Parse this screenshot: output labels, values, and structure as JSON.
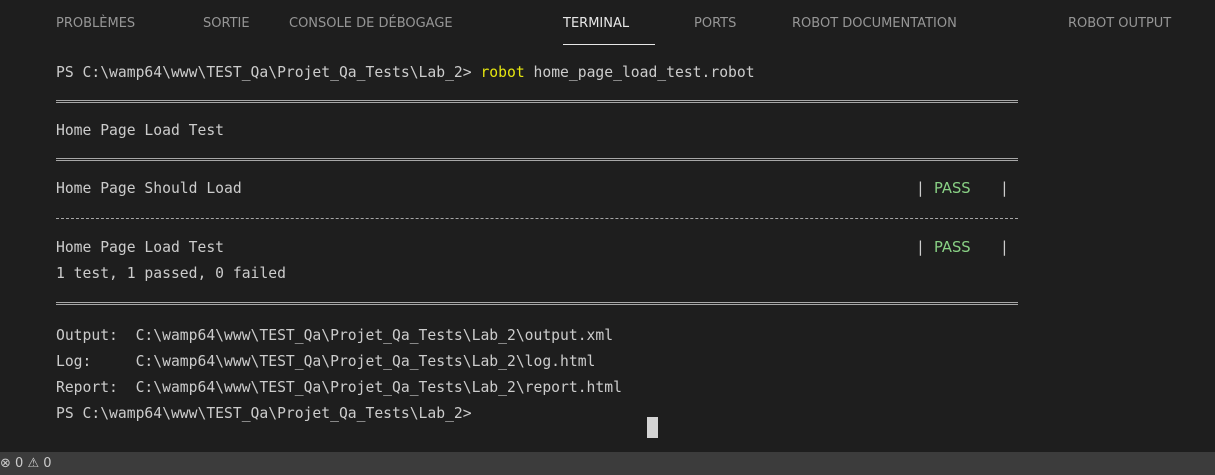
{
  "panel": {
    "tabs": [
      {
        "label": "PROBLÈMES"
      },
      {
        "label": "SORTIE"
      },
      {
        "label": "CONSOLE DE DÉBOGAGE"
      },
      {
        "label": "TERMINAL"
      },
      {
        "label": "PORTS"
      },
      {
        "label": "ROBOT DOCUMENTATION"
      },
      {
        "label": "ROBOT OUTPUT"
      }
    ],
    "active_tab": "TERMINAL"
  },
  "terminal": {
    "prompt1": "PS C:\\wamp64\\www\\TEST_Qa\\Projet_Qa_Tests\\Lab_2> ",
    "command": "robot",
    "command_args": " home_page_load_test.robot",
    "suite_title": "Home Page Load Test",
    "test_name": "Home Page Should Load",
    "test_status": "PASS",
    "suite_name": "Home Page Load Test",
    "suite_status": "PASS",
    "summary": "1 test, 1 passed, 0 failed",
    "output_line": "Output:  C:\\wamp64\\www\\TEST_Qa\\Projet_Qa_Tests\\Lab_2\\output.xml",
    "log_line": "Log:     C:\\wamp64\\www\\TEST_Qa\\Projet_Qa_Tests\\Lab_2\\log.html",
    "report_line": "Report:  C:\\wamp64\\www\\TEST_Qa\\Projet_Qa_Tests\\Lab_2\\report.html",
    "prompt2": "PS C:\\wamp64\\www\\TEST_Qa\\Projet_Qa_Tests\\Lab_2> "
  },
  "statusbar": {
    "errors_count": "0",
    "warnings_count": "0",
    "error_icon": "⊗",
    "warning_icon": "⚠"
  },
  "colors": {
    "background": "#1e1e1e",
    "statusbar": "#3c3c3c",
    "pass": "#89d185",
    "command": "#e5e510"
  }
}
